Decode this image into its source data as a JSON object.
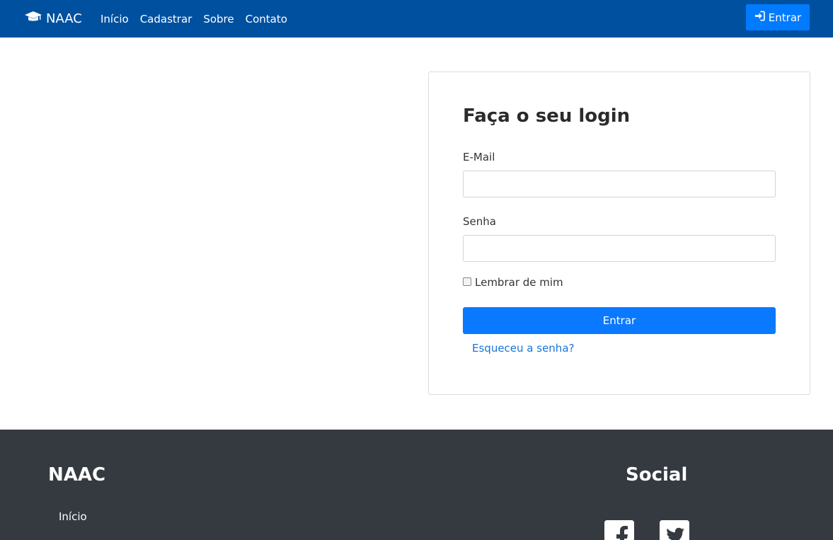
{
  "navbar": {
    "brand": "NAAC",
    "brand_icon": "graduation-cap-icon",
    "links": [
      "Início",
      "Cadastrar",
      "Sobre",
      "Contato"
    ],
    "login_button": "Entrar",
    "login_icon": "sign-in-icon",
    "background": "#0050a0",
    "button_color": "#007bff"
  },
  "login": {
    "title": "Faça o seu login",
    "email_label": "E-Mail",
    "email_value": "",
    "password_label": "Senha",
    "password_value": "",
    "remember_label": "Lembrar de mim",
    "remember_checked": false,
    "submit_label": "Entrar",
    "forgot_link": "Esqueceu a senha?",
    "button_color": "#0a79ff"
  },
  "footer": {
    "title": "NAAC",
    "links": [
      "Início"
    ],
    "social_title": "Social",
    "social_icons": [
      "facebook-icon",
      "twitter-icon"
    ],
    "background": "#343a40"
  }
}
